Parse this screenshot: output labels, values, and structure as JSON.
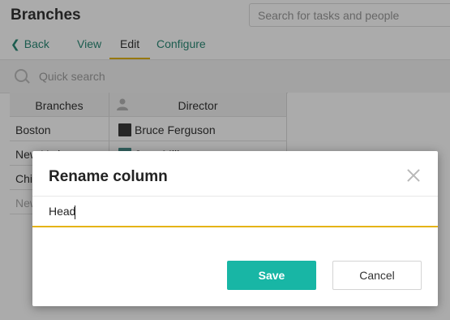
{
  "page": {
    "title": "Branches",
    "search_placeholder": "Search for tasks and people"
  },
  "nav": {
    "back": "Back",
    "view": "View",
    "edit": "Edit",
    "configure": "Configure"
  },
  "quick_search": {
    "placeholder": "Quick search"
  },
  "grid": {
    "headers": [
      "Branches",
      "Director"
    ],
    "rows": [
      {
        "branch": "Boston",
        "director": "Bruce Ferguson"
      },
      {
        "branch": "New York",
        "director": "Jane Miller"
      },
      {
        "branch": "Chicago",
        "director": ""
      },
      {
        "branch": "New",
        "director": ""
      }
    ]
  },
  "dialog": {
    "title": "Rename column",
    "input_value": "Head",
    "save_label": "Save",
    "cancel_label": "Cancel"
  },
  "colors": {
    "accent_teal": "#18b6a5",
    "tab_underline": "#e0b418",
    "link_green": "#2b8a76"
  }
}
